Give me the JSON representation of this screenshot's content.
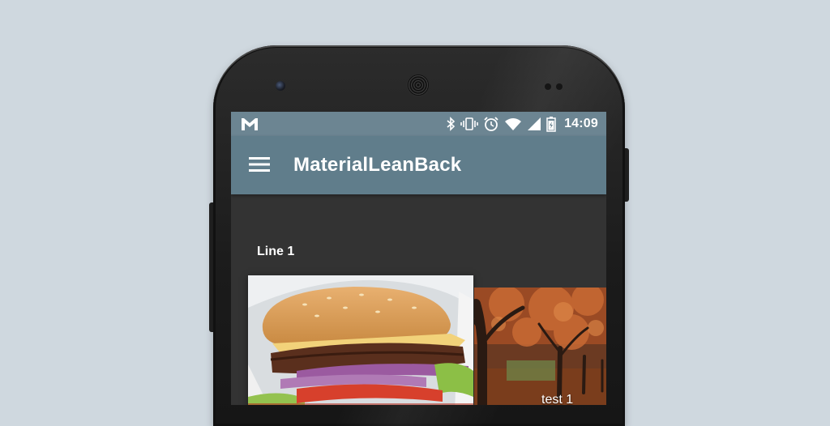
{
  "status_bar": {
    "time": "14:09",
    "icons": [
      "gmail-icon",
      "bluetooth-icon",
      "vibrate-icon",
      "alarm-icon",
      "wifi-icon",
      "signal-icon",
      "battery-icon"
    ]
  },
  "toolbar": {
    "title": "MaterialLeanBack",
    "menu_icon": "menu-icon"
  },
  "content": {
    "rows": [
      {
        "title": "Line 1",
        "cards": [
          {
            "image": "burger-image",
            "caption": ""
          },
          {
            "image": "autumn-trees-image",
            "caption": "test 1"
          }
        ]
      }
    ]
  },
  "colors": {
    "background": "#cfd8df",
    "toolbar": "#607d8b",
    "status_bar": "#6c8592",
    "screen_background": "#333333"
  }
}
